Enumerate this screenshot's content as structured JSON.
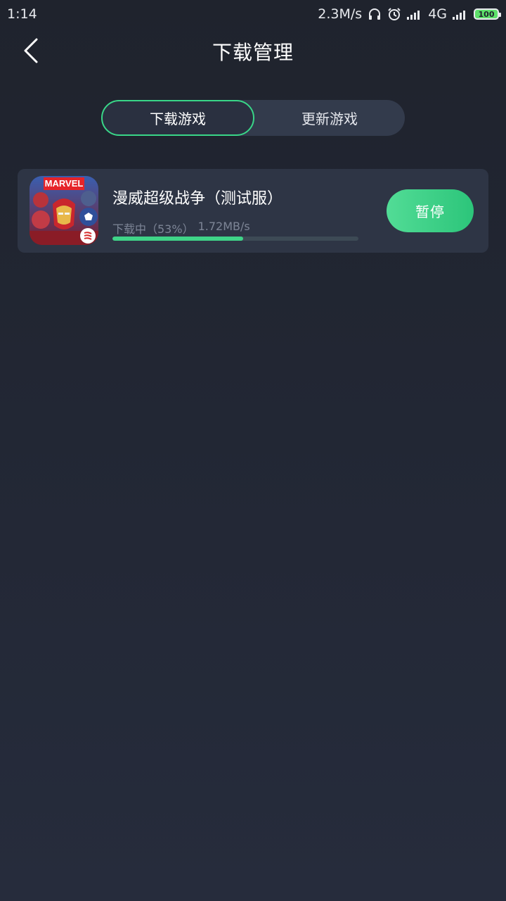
{
  "status_bar": {
    "time": "1:14",
    "net_speed": "2.3M/s",
    "network_type": "4G",
    "network_sub": "ıl",
    "battery": "100",
    "icons": [
      "headphones-icon",
      "alarm-icon",
      "signal-icon",
      "signal-icon",
      "battery-icon"
    ]
  },
  "header": {
    "title": "下载管理",
    "back_icon": "chevron-left-icon"
  },
  "tabs": [
    {
      "label": "下载游戏",
      "active": true
    },
    {
      "label": "更新游戏",
      "active": false
    }
  ],
  "downloads": [
    {
      "title": "漫威超级战争（测试服）",
      "status_label": "下载中（53%）",
      "speed": "1.72MB/s",
      "progress": 0.53,
      "action_label": "暂停",
      "icon": "marvel-game-icon",
      "icon_text": "MARVEL"
    }
  ],
  "colors": {
    "accent": "#39d688",
    "background": "#222733",
    "card": "#2e3545",
    "tab_track": "#333b4c"
  }
}
